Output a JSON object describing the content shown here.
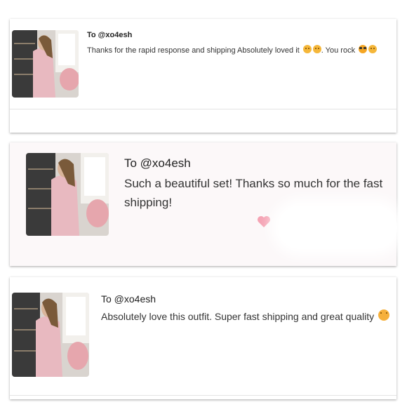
{
  "reviews": [
    {
      "to": "To @xo4esh",
      "message": "Thanks for the rapid response and shipping Absolutely loved it",
      "message_tail": ". You rock",
      "emojis_mid": [
        "smiling-face-emoji",
        "smiling-face-emoji"
      ],
      "emojis_end": [
        "sunglasses-face-emoji",
        "smiling-face-emoji"
      ]
    },
    {
      "to": "To @xo4esh",
      "message": "Such a beautiful set! Thanks so much for the fast shipping!",
      "heart_icon": "heart-icon",
      "heart_color": "#f5a3b4"
    },
    {
      "to": "To @xo4esh",
      "message": "Absolutely love this outfit. Super fast shipping and great quality",
      "emojis_end": [
        "kissing-face-emoji"
      ]
    }
  ],
  "colors": {
    "photo_pink": "#e8b9c0",
    "shelf_dark": "#3a3a3a",
    "chair_pink": "#e6a6ad",
    "card2_background": "#fcf8f9"
  }
}
